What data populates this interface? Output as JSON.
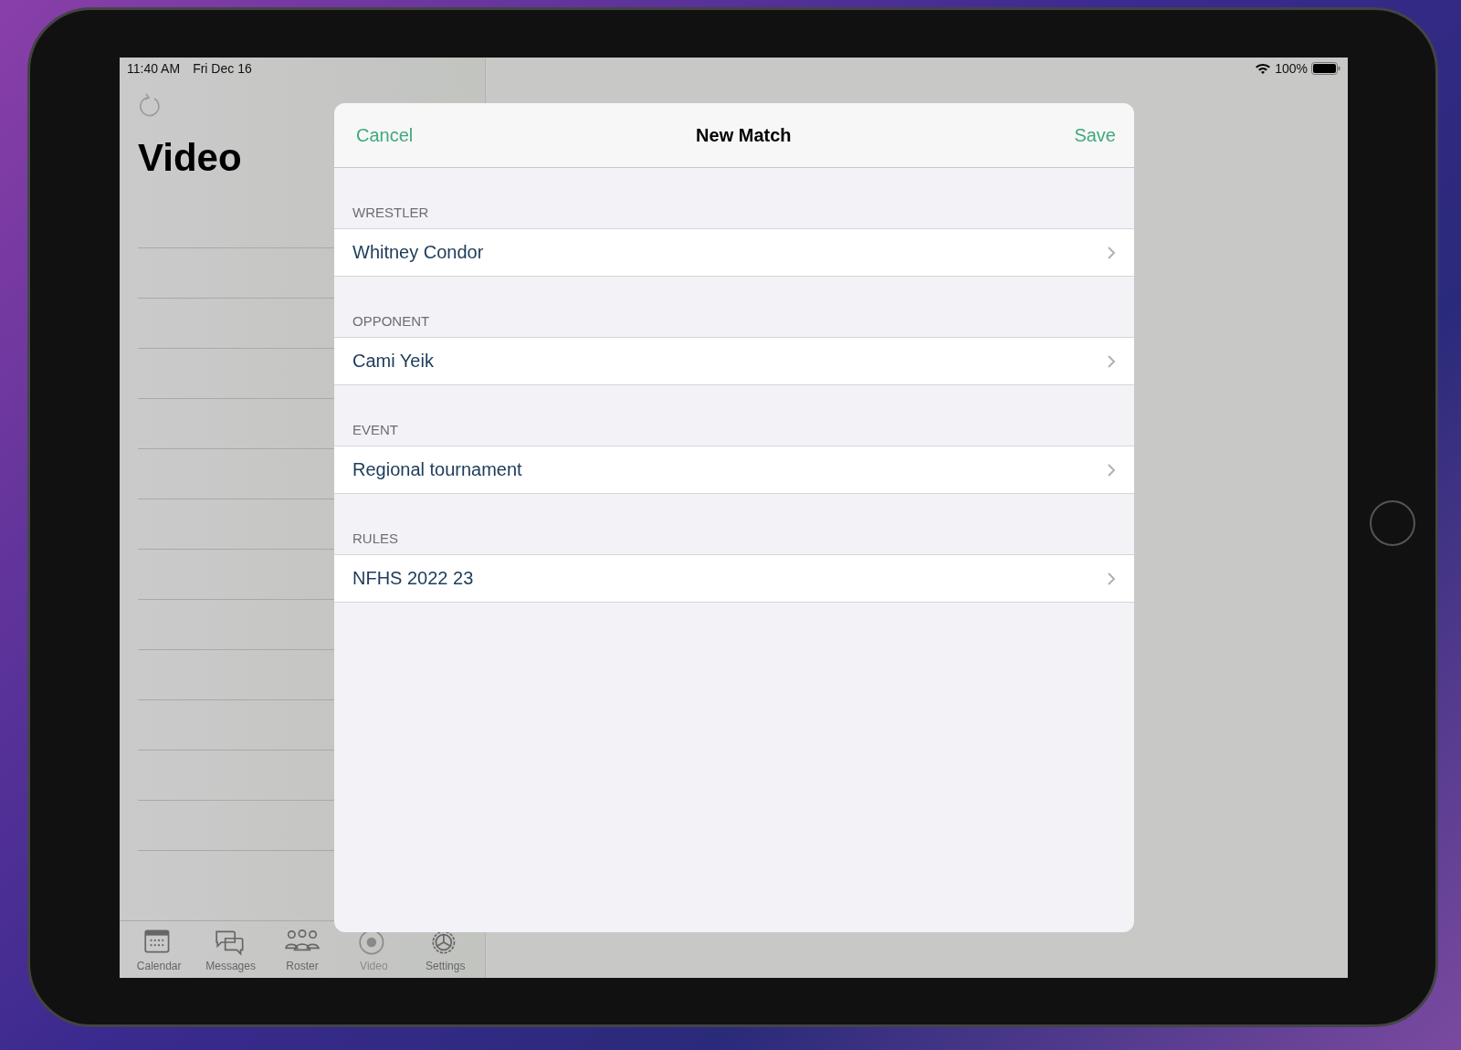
{
  "status_bar": {
    "time": "11:40 AM",
    "date": "Fri Dec 16",
    "battery": "100%"
  },
  "sidebar": {
    "title": "Video"
  },
  "tabs": [
    {
      "label": "Calendar",
      "kind": "calendar",
      "selected": false
    },
    {
      "label": "Messages",
      "kind": "messages",
      "selected": false
    },
    {
      "label": "Roster",
      "kind": "roster",
      "selected": false
    },
    {
      "label": "Video",
      "kind": "video",
      "selected": true
    },
    {
      "label": "Settings",
      "kind": "settings",
      "selected": false
    }
  ],
  "modal": {
    "title": "New Match",
    "cancel": "Cancel",
    "save": "Save",
    "sections": [
      {
        "header": "WRESTLER",
        "value": "Whitney Condor"
      },
      {
        "header": "OPPONENT",
        "value": "Cami Yeik"
      },
      {
        "header": "EVENT",
        "value": "Regional tournament"
      },
      {
        "header": "RULES",
        "value": "NFHS 2022 23"
      }
    ]
  }
}
